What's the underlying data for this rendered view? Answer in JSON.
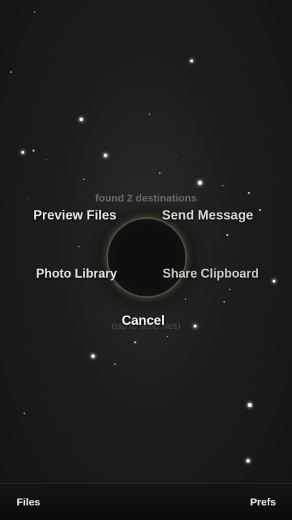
{
  "status": {
    "found_text": "found 2 destinations",
    "hint_text": "(tap to send files)"
  },
  "actions": {
    "preview_files": "Preview Files",
    "send_message": "Send Message",
    "photo_library": "Photo Library",
    "share_clipboard": "Share Clipboard",
    "cancel": "Cancel"
  },
  "tabbar": {
    "files": "Files",
    "prefs": "Prefs"
  },
  "colors": {
    "background": "#1c1c1c",
    "ring_glow": "#b4a06e",
    "label": "#e8e8e8"
  }
}
